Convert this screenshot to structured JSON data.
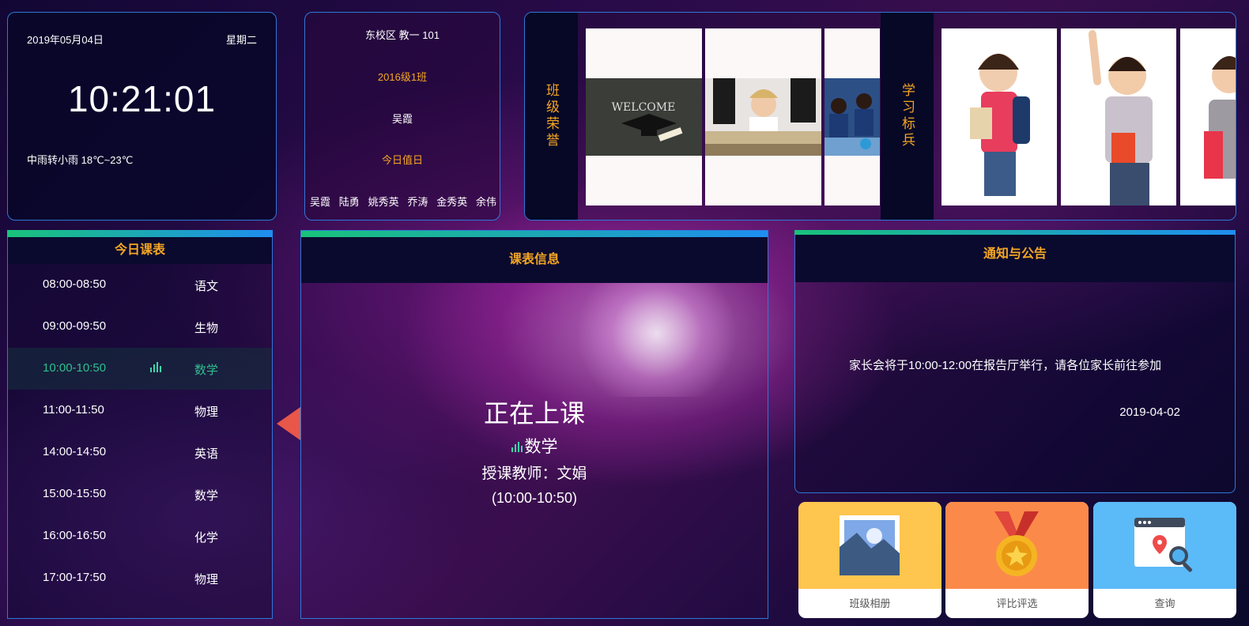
{
  "datetime": {
    "date": "2019年05月04日",
    "weekday": "星期二",
    "time": "10:21:01",
    "weather": "中雨转小雨 18℃~23℃"
  },
  "class_info": {
    "room": "东校区 教一 101",
    "class_name": "2016级1班",
    "head_teacher": "吴霞",
    "duty_label": "今日值日",
    "duty_students": [
      "吴霞",
      "陆勇",
      "姚秀英",
      "乔涛",
      "金秀英",
      "余伟"
    ]
  },
  "honors": {
    "class_honor_label": "班级荣誉",
    "study_model_label": "学习标兵"
  },
  "schedule": {
    "title": "今日课表",
    "rows": [
      {
        "time": "08:00-08:50",
        "subject": "语文"
      },
      {
        "time": "09:00-09:50",
        "subject": "生物"
      },
      {
        "time": "10:00-10:50",
        "subject": "数学"
      },
      {
        "time": "11:00-11:50",
        "subject": "物理"
      },
      {
        "time": "14:00-14:50",
        "subject": "英语"
      },
      {
        "time": "15:00-15:50",
        "subject": "数学"
      },
      {
        "time": "16:00-16:50",
        "subject": "化学"
      },
      {
        "time": "17:00-17:50",
        "subject": "物理"
      }
    ]
  },
  "lesson": {
    "title": "课表信息",
    "status": "正在上课",
    "subject": "数学",
    "teacher": "授课教师：文娟",
    "period": "(10:00-10:50)"
  },
  "notice": {
    "title": "通知与公告",
    "message": "家长会将于10:00-12:00在报告厅举行，请各位家长前往参加",
    "date": "2019-04-02"
  },
  "tiles": [
    {
      "label": "班级相册",
      "icon": "photo-album-icon",
      "color": "#fec54f"
    },
    {
      "label": "评比评选",
      "icon": "medal-icon",
      "color": "#fb8a4a"
    },
    {
      "label": "查询",
      "icon": "search-location-icon",
      "color": "#5bbaf8"
    }
  ],
  "colors": {
    "accent": "#f5a623",
    "border": "#2e78d8",
    "active": "#2fbf8f",
    "arrow": "#e8574a"
  }
}
